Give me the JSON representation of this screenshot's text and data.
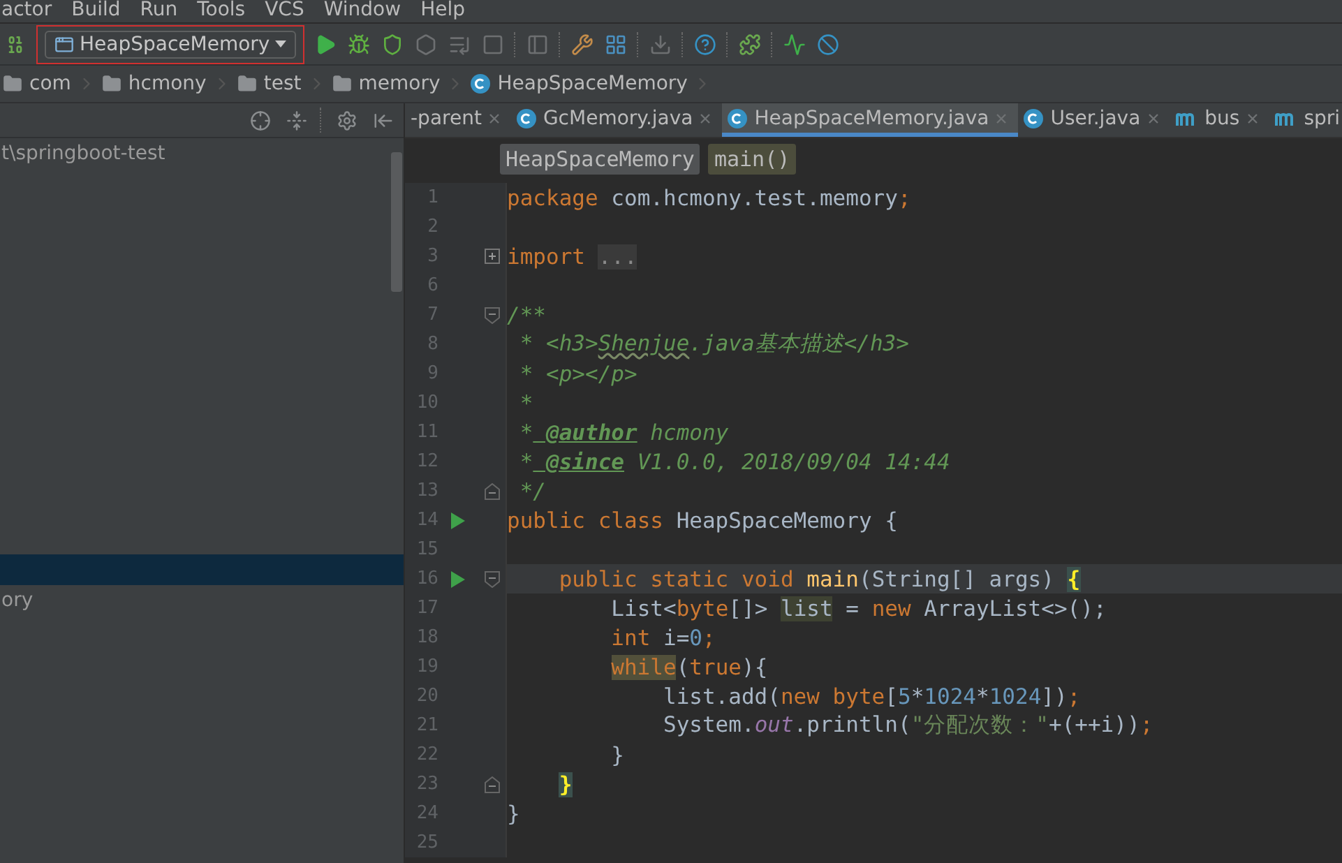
{
  "menu": [
    "actor",
    "Build",
    "Run",
    "Tools",
    "VCS",
    "Window",
    "Help"
  ],
  "toolbar": {
    "run_config": {
      "label": "HeapSpaceMemory",
      "highlighted": true
    }
  },
  "breadcrumbs": [
    {
      "label": "com",
      "kind": "folder"
    },
    {
      "label": "hcmony",
      "kind": "folder"
    },
    {
      "label": "test",
      "kind": "folder"
    },
    {
      "label": "memory",
      "kind": "folder"
    },
    {
      "label": "HeapSpaceMemory",
      "kind": "class"
    }
  ],
  "project_panel": {
    "items": [
      {
        "label": "t\\springboot-test",
        "selected": false
      },
      {
        "selected": true
      },
      {
        "label": "ory",
        "selected": false
      }
    ]
  },
  "editor_tabs": [
    {
      "label": "-parent",
      "kind": "plain",
      "selected": false
    },
    {
      "label": "GcMemory.java",
      "kind": "class",
      "selected": false
    },
    {
      "label": "HeapSpaceMemory.java",
      "kind": "class",
      "selected": true
    },
    {
      "label": "User.java",
      "kind": "class",
      "selected": false
    },
    {
      "label": "bus",
      "kind": "module",
      "selected": false
    },
    {
      "label": "spri",
      "kind": "module",
      "selected": false
    }
  ],
  "structure_path": [
    "HeapSpaceMemory",
    "main()"
  ],
  "code_lines": [
    {
      "number": "1",
      "run": false,
      "folded": false,
      "fold_start": false,
      "fold_end": false,
      "current": false,
      "tokens": [
        {
          "kind": "kw",
          "text": "package"
        },
        {
          "kind": "pl",
          "text": " com.hcmony.test.memory"
        },
        {
          "kind": "kw",
          "text": ";"
        }
      ]
    },
    {
      "number": "2",
      "run": false,
      "folded": false,
      "fold_start": false,
      "fold_end": false,
      "current": false
    },
    {
      "number": "3",
      "run": false,
      "folded": true,
      "fold_start": false,
      "fold_end": false,
      "current": false,
      "tokens": [
        {
          "kind": "kw",
          "text": "import "
        },
        {
          "kind": "ph",
          "text": "..."
        }
      ]
    },
    {
      "number": "6",
      "run": false,
      "folded": false,
      "fold_start": false,
      "fold_end": false,
      "current": false
    },
    {
      "number": "7",
      "run": false,
      "folded": false,
      "fold_start": true,
      "fold_end": false,
      "current": false,
      "tokens": [
        {
          "kind": "cm",
          "text": "/**"
        }
      ]
    },
    {
      "number": "8",
      "run": false,
      "folded": false,
      "fold_start": false,
      "fold_end": false,
      "current": false,
      "tokens": [
        {
          "kind": "cm",
          "text": " * <h3>"
        },
        {
          "kind": "typo",
          "text": "Shenjue"
        },
        {
          "kind": "cm",
          "text": ".java基本描述</h3>"
        }
      ]
    },
    {
      "number": "9",
      "run": false,
      "folded": false,
      "fold_start": false,
      "fold_end": false,
      "current": false,
      "tokens": [
        {
          "kind": "cm",
          "text": " * <p></p>"
        }
      ]
    },
    {
      "number": "10",
      "run": false,
      "folded": false,
      "fold_start": false,
      "fold_end": false,
      "current": false,
      "tokens": [
        {
          "kind": "cm",
          "text": " *"
        }
      ]
    },
    {
      "number": "11",
      "run": false,
      "folded": false,
      "fold_start": false,
      "fold_end": false,
      "current": false,
      "tokens": [
        {
          "kind": "cm",
          "text": " *"
        },
        {
          "kind": "tag",
          "text": " @author"
        },
        {
          "kind": "cm",
          "text": " hcmony"
        }
      ]
    },
    {
      "number": "12",
      "run": false,
      "folded": false,
      "fold_start": false,
      "fold_end": false,
      "current": false,
      "tokens": [
        {
          "kind": "cm",
          "text": " *"
        },
        {
          "kind": "tag",
          "text": " @since"
        },
        {
          "kind": "cm",
          "text": " V1.0.0, 2018/09/04 14:44"
        }
      ]
    },
    {
      "number": "13",
      "run": false,
      "folded": false,
      "fold_start": false,
      "fold_end": true,
      "current": false,
      "tokens": [
        {
          "kind": "cm",
          "text": " */"
        }
      ]
    },
    {
      "number": "14",
      "run": true,
      "folded": false,
      "fold_start": false,
      "fold_end": false,
      "current": false,
      "tokens": [
        {
          "kind": "kw",
          "text": "public class"
        },
        {
          "kind": "pl",
          "text": " HeapSpaceMemory {"
        }
      ]
    },
    {
      "number": "15",
      "run": false,
      "folded": false,
      "fold_start": false,
      "fold_end": false,
      "current": false
    },
    {
      "number": "16",
      "run": true,
      "folded": false,
      "fold_start": true,
      "fold_end": false,
      "current": true,
      "tokens": [
        {
          "kind": "kw",
          "text": "    public static void"
        },
        {
          "kind": "fn",
          "text": " main"
        },
        {
          "kind": "pl",
          "text": "(String[] args) "
        },
        {
          "kind": "bm",
          "text": "{"
        }
      ]
    },
    {
      "number": "17",
      "run": false,
      "folded": false,
      "fold_start": false,
      "fold_end": false,
      "current": false,
      "tokens": [
        {
          "kind": "pl",
          "text": "        List<"
        },
        {
          "kind": "kw",
          "text": "byte"
        },
        {
          "kind": "pl",
          "text": "[]> "
        },
        {
          "kind": "hl",
          "text": "list"
        },
        {
          "kind": "pl",
          "text": " = "
        },
        {
          "kind": "kw",
          "text": "new"
        },
        {
          "kind": "pl",
          "text": " ArrayList<>();"
        }
      ]
    },
    {
      "number": "18",
      "run": false,
      "folded": false,
      "fold_start": false,
      "fold_end": false,
      "current": false,
      "tokens": [
        {
          "kind": "kw",
          "text": "        int"
        },
        {
          "kind": "pl",
          "text": " i="
        },
        {
          "kind": "num",
          "text": "0"
        },
        {
          "kind": "kw",
          "text": ";"
        }
      ]
    },
    {
      "number": "19",
      "run": false,
      "folded": false,
      "fold_start": false,
      "fold_end": false,
      "current": false,
      "tokens": [
        {
          "kind": "hlk",
          "text": "while",
          "indent_text": true
        },
        {
          "kind": "pl",
          "text": "("
        },
        {
          "kind": "kw",
          "text": "true"
        },
        {
          "kind": "pl",
          "text": "){"
        }
      ]
    },
    {
      "number": "20",
      "run": false,
      "folded": false,
      "fold_start": false,
      "fold_end": false,
      "current": false,
      "tokens": [
        {
          "kind": "pl",
          "text": "            list.add("
        },
        {
          "kind": "kw",
          "text": "new byte"
        },
        {
          "kind": "pl",
          "text": "["
        },
        {
          "kind": "num",
          "text": "5"
        },
        {
          "kind": "pl",
          "text": "*"
        },
        {
          "kind": "num",
          "text": "1024"
        },
        {
          "kind": "pl",
          "text": "*"
        },
        {
          "kind": "num",
          "text": "1024"
        },
        {
          "kind": "pl",
          "text": "])"
        },
        {
          "kind": "kw",
          "text": ";"
        }
      ]
    },
    {
      "number": "21",
      "run": false,
      "folded": false,
      "fold_start": false,
      "fold_end": false,
      "current": false,
      "tokens": [
        {
          "kind": "pl",
          "text": "            System."
        },
        {
          "kind": "fld",
          "text": "out"
        },
        {
          "kind": "pl",
          "text": ".println("
        },
        {
          "kind": "str",
          "text": "\"分配次数：\""
        },
        {
          "kind": "pl",
          "text": "+(++i))"
        },
        {
          "kind": "kw",
          "text": ";"
        }
      ]
    },
    {
      "number": "22",
      "run": false,
      "folded": false,
      "fold_start": false,
      "fold_end": false,
      "current": false,
      "tokens": [
        {
          "kind": "pl",
          "text": "        }"
        }
      ]
    },
    {
      "number": "23",
      "run": false,
      "folded": false,
      "fold_start": false,
      "fold_end": true,
      "current": false,
      "tokens": [
        {
          "kind": "bm",
          "text": "}",
          "indent_text": true
        }
      ]
    },
    {
      "number": "24",
      "run": false,
      "folded": false,
      "fold_start": false,
      "fold_end": false,
      "current": false,
      "tokens": [
        {
          "kind": "pl",
          "text": "}"
        }
      ]
    },
    {
      "number": "25",
      "run": false,
      "folded": false,
      "fold_start": false,
      "fold_end": false,
      "current": false
    }
  ]
}
